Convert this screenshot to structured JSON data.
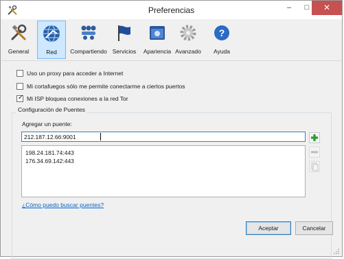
{
  "window": {
    "title": "Preferencias",
    "minimize_glyph": "–",
    "maximize_glyph": "□",
    "close_glyph": "✕"
  },
  "toolbar": {
    "items": [
      {
        "label": "General",
        "icon": "tools-icon"
      },
      {
        "label": "Red",
        "icon": "network-globe-icon",
        "active": true
      },
      {
        "label": "Compartiendo",
        "icon": "sharing-people-icon"
      },
      {
        "label": "Servicios",
        "icon": "flag-icon"
      },
      {
        "label": "Apariencia",
        "icon": "appearance-window-icon"
      },
      {
        "label": "Avanzado",
        "icon": "gear-icon"
      },
      {
        "label": "Ayuda",
        "icon": "help-icon"
      }
    ]
  },
  "options": {
    "proxy": {
      "label": "Uso un proxy para acceder a Internet",
      "checked": false
    },
    "firewall": {
      "label": "Mi cortafuegos sólo me permite conectarme a ciertos puertos",
      "checked": false
    },
    "isp_block": {
      "label": "Mi ISP bloquea conexiones a la red Tor",
      "checked": true
    }
  },
  "bridges": {
    "group_title": "Configuración de Puentes",
    "add_label": "Agregar un puente:",
    "input_value": "212.187.12.66:9001",
    "list": [
      "198.24.181.74:443",
      "176.34.69.142:443"
    ],
    "help_link": "¿Cómo puedo buscar puentes?"
  },
  "buttons": {
    "accept": "Aceptar",
    "cancel": "Cancelar"
  },
  "colors": {
    "accent": "#3c7fb1",
    "active_tab": "#cde8ff",
    "close": "#c75050",
    "link": "#0066cc"
  }
}
